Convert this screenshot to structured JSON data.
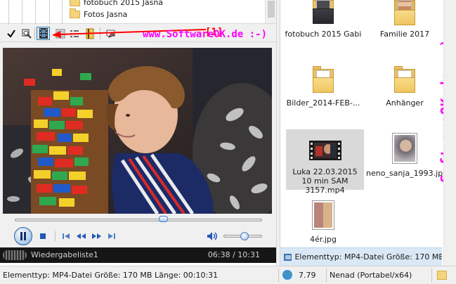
{
  "tree": {
    "items": [
      {
        "label": "fotobuch 2015 Jasna"
      },
      {
        "label": "Fotos Jasna"
      }
    ]
  },
  "toolbar": {
    "callout_label": "[1]",
    "buttons": [
      {
        "icon": "check-icon"
      },
      {
        "icon": "zoom-icon"
      },
      {
        "icon": "film-strip-icon",
        "active": true
      },
      {
        "icon": "large-icons-view-icon"
      },
      {
        "icon": "details-view-icon"
      },
      {
        "icon": "book-icon"
      },
      {
        "icon": "eraser-icon"
      }
    ]
  },
  "watermark": {
    "text": "www.SoftwareOK.de :-)",
    "color": "#ff00ff"
  },
  "player": {
    "seek_position": 0.6,
    "volume": 0.55,
    "playlist_name": "Wiedergabeliste1",
    "time_display": "06:38 / 10:31"
  },
  "files": [
    {
      "label": "fotobuch 2015 Gabi",
      "kind": "photo-folder"
    },
    {
      "label": "Familie 2017",
      "kind": "photo-folder"
    },
    {
      "label": "Bilder_2014-FEB-...",
      "kind": "folder"
    },
    {
      "label": "Anhänger",
      "kind": "folder"
    },
    {
      "label": "Luka 22.03.2015 10 min SAM 3157.mp4",
      "kind": "video",
      "selected": true
    },
    {
      "label": "neno_sanja_1993.jpg",
      "kind": "image"
    },
    {
      "label": "4ér.jpg",
      "kind": "image"
    }
  ],
  "right_status": {
    "text": "Elementtyp: MP4-Datei Größe: 170 MB Län"
  },
  "statusbar": {
    "info": "Elementtyp: MP4-Datei Größe: 170 MB Länge: 00:10:31",
    "version": "7.79",
    "user": "Nenad (Portabel/x64)"
  },
  "colors": {
    "callout_red": "#ff0000",
    "accent_blue": "#3c7fb1",
    "selection_grey": "#d9d9d9",
    "status_blue": "#dae8f6"
  }
}
